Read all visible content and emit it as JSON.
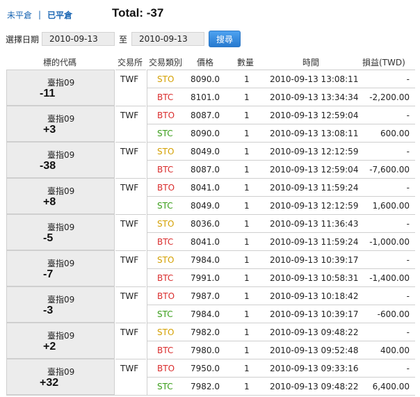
{
  "nav": {
    "open_label": "未平倉",
    "separator": "|",
    "closed_label": "已平倉"
  },
  "total": "Total: -37",
  "filter": {
    "date_label": "選擇日期",
    "from_value": "2010-09-13",
    "to_label": "至",
    "to_value": "2010-09-13",
    "search_label": "搜尋"
  },
  "headers": {
    "code": "標的代碼",
    "exchange": "交易所",
    "type": "交易類別",
    "price": "價格",
    "qty": "數量",
    "time": "時間",
    "pl": "損益(TWD)"
  },
  "colors": {
    "sto": "#d4a000",
    "stc": "#3a9e1a",
    "btc": "#d92b2b",
    "bto": "#d92b2b",
    "accent": "#1a66b3"
  },
  "groups": [
    {
      "name": "臺指09",
      "pl": "-11",
      "exchange": "TWF",
      "rows": [
        {
          "type": "STO",
          "price": "8090.0",
          "qty": "1",
          "time": "2010-09-13 13:08:11",
          "pl": "-"
        },
        {
          "type": "BTC",
          "price": "8101.0",
          "qty": "1",
          "time": "2010-09-13 13:34:34",
          "pl": "-2,200.00"
        }
      ]
    },
    {
      "name": "臺指09",
      "pl": "+3",
      "exchange": "TWF",
      "rows": [
        {
          "type": "BTO",
          "price": "8087.0",
          "qty": "1",
          "time": "2010-09-13 12:59:04",
          "pl": "-"
        },
        {
          "type": "STC",
          "price": "8090.0",
          "qty": "1",
          "time": "2010-09-13 13:08:11",
          "pl": "600.00"
        }
      ]
    },
    {
      "name": "臺指09",
      "pl": "-38",
      "exchange": "TWF",
      "rows": [
        {
          "type": "STO",
          "price": "8049.0",
          "qty": "1",
          "time": "2010-09-13 12:12:59",
          "pl": "-"
        },
        {
          "type": "BTC",
          "price": "8087.0",
          "qty": "1",
          "time": "2010-09-13 12:59:04",
          "pl": "-7,600.00"
        }
      ]
    },
    {
      "name": "臺指09",
      "pl": "+8",
      "exchange": "TWF",
      "rows": [
        {
          "type": "BTO",
          "price": "8041.0",
          "qty": "1",
          "time": "2010-09-13 11:59:24",
          "pl": "-"
        },
        {
          "type": "STC",
          "price": "8049.0",
          "qty": "1",
          "time": "2010-09-13 12:12:59",
          "pl": "1,600.00"
        }
      ]
    },
    {
      "name": "臺指09",
      "pl": "-5",
      "exchange": "TWF",
      "rows": [
        {
          "type": "STO",
          "price": "8036.0",
          "qty": "1",
          "time": "2010-09-13 11:36:43",
          "pl": "-"
        },
        {
          "type": "BTC",
          "price": "8041.0",
          "qty": "1",
          "time": "2010-09-13 11:59:24",
          "pl": "-1,000.00"
        }
      ]
    },
    {
      "name": "臺指09",
      "pl": "-7",
      "exchange": "TWF",
      "rows": [
        {
          "type": "STO",
          "price": "7984.0",
          "qty": "1",
          "time": "2010-09-13 10:39:17",
          "pl": "-"
        },
        {
          "type": "BTC",
          "price": "7991.0",
          "qty": "1",
          "time": "2010-09-13 10:58:31",
          "pl": "-1,400.00"
        }
      ]
    },
    {
      "name": "臺指09",
      "pl": "-3",
      "exchange": "TWF",
      "rows": [
        {
          "type": "BTO",
          "price": "7987.0",
          "qty": "1",
          "time": "2010-09-13 10:18:42",
          "pl": "-"
        },
        {
          "type": "STC",
          "price": "7984.0",
          "qty": "1",
          "time": "2010-09-13 10:39:17",
          "pl": "-600.00"
        }
      ]
    },
    {
      "name": "臺指09",
      "pl": "+2",
      "exchange": "TWF",
      "rows": [
        {
          "type": "STO",
          "price": "7982.0",
          "qty": "1",
          "time": "2010-09-13 09:48:22",
          "pl": "-"
        },
        {
          "type": "BTC",
          "price": "7980.0",
          "qty": "1",
          "time": "2010-09-13 09:52:48",
          "pl": "400.00"
        }
      ]
    },
    {
      "name": "臺指09",
      "pl": "+32",
      "exchange": "TWF",
      "rows": [
        {
          "type": "BTO",
          "price": "7950.0",
          "qty": "1",
          "time": "2010-09-13 09:33:16",
          "pl": "-"
        },
        {
          "type": "STC",
          "price": "7982.0",
          "qty": "1",
          "time": "2010-09-13 09:48:22",
          "pl": "6,400.00"
        }
      ]
    }
  ]
}
